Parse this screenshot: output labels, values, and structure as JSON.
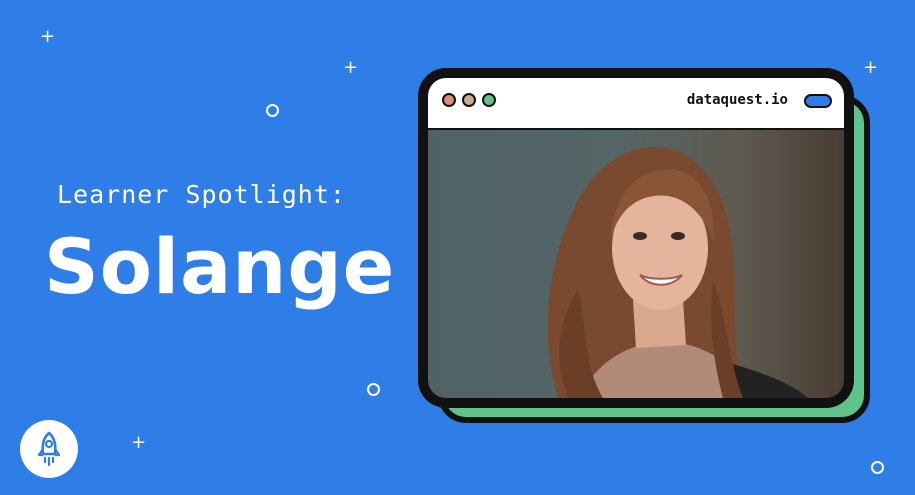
{
  "banner": {
    "subtitle": "Learner Spotlight:",
    "name": "Solange",
    "logo_icon": "rocket-icon"
  },
  "browser": {
    "url": "dataquest.io",
    "photo_alt": "Portrait of Solange"
  },
  "colors": {
    "background": "#2F7DE6",
    "accent_green": "#5EC48C",
    "window_border": "#111111"
  }
}
